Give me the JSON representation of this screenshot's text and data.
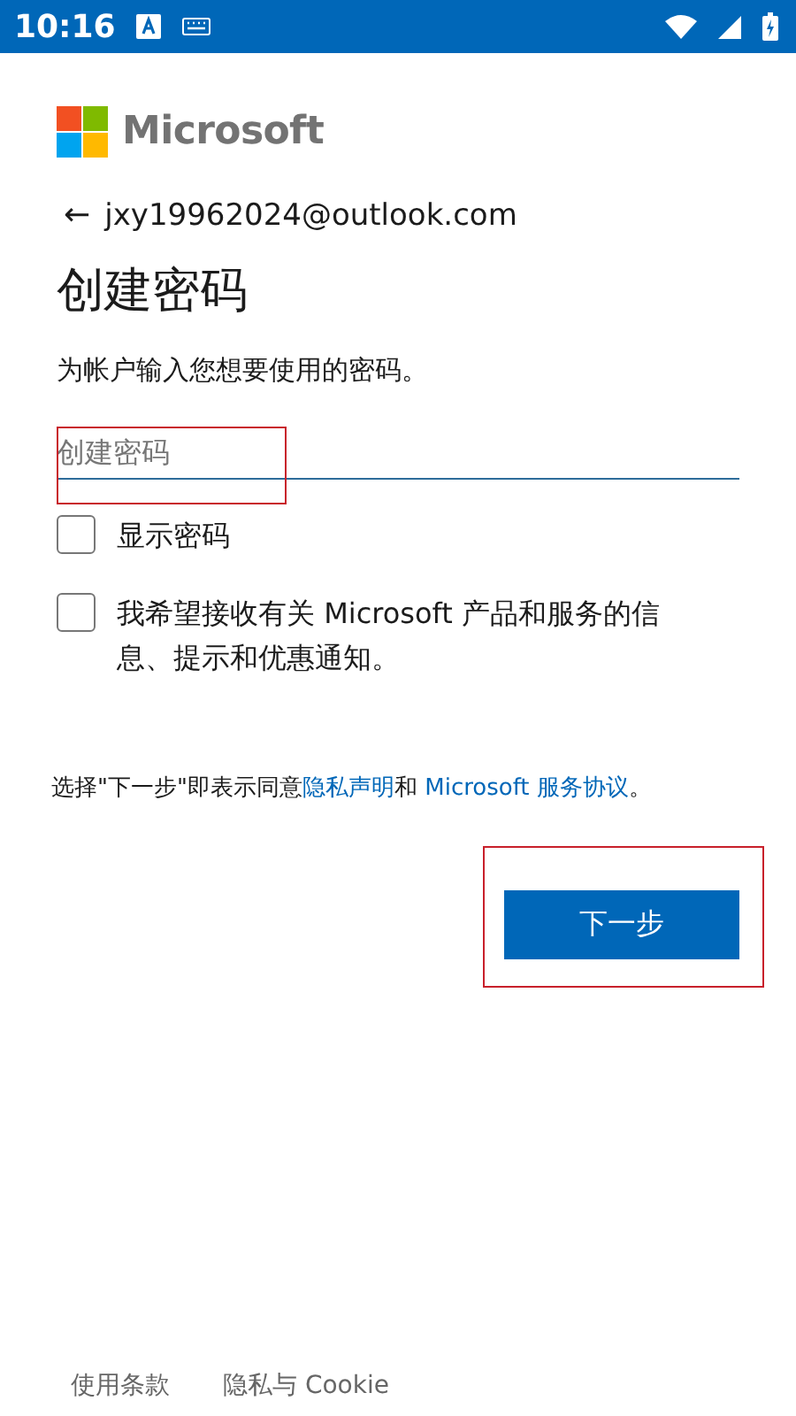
{
  "status_bar": {
    "time": "10:16"
  },
  "brand": {
    "name": "Microsoft"
  },
  "account": {
    "back": "←",
    "email": "jxy19962024@outlook.com"
  },
  "title": "创建密码",
  "subtitle": "为帐户输入您想要使用的密码。",
  "password_field": {
    "placeholder": "创建密码"
  },
  "checkboxes": [
    {
      "label": "显示密码",
      "checked": false
    },
    {
      "label": "我希望接收有关 Microsoft 产品和服务的信息、提示和优惠通知。",
      "checked": false
    }
  ],
  "legal": [
    {
      "kind": "text",
      "text": "选择\"下一步\"即表示同意"
    },
    {
      "kind": "link",
      "text": "隐私声明"
    },
    {
      "kind": "text",
      "text": "和 "
    },
    {
      "kind": "link",
      "text": "Microsoft 服务协议"
    },
    {
      "kind": "text",
      "text": "。"
    }
  ],
  "next_button": "下一步",
  "footer": [
    "使用条款",
    "隐私与 Cookie"
  ]
}
